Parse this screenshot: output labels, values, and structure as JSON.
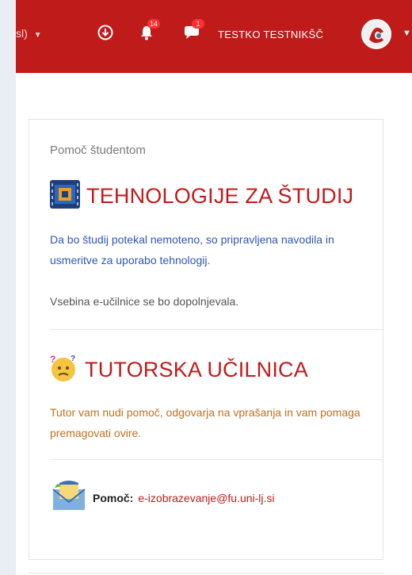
{
  "navbar": {
    "lang_label": "sl)",
    "notif_count": "14",
    "msg_count": "1",
    "user_name": "TESTKO TESTNIKŠČ"
  },
  "block": {
    "title": "Pomoč študentom",
    "section1": {
      "heading": "TEHNOLOGIJE ZA ŠTUDIJ",
      "text": "Da bo študij potekal nemoteno, so pripravljena navodila in usmeritve za uporabo tehnologij.",
      "note": "Vsebina e-učilnice se bo dopolnjevala."
    },
    "section2": {
      "heading": "TUTORSKA UČILNICA",
      "text": "Tutor vam nudi pomoč, odgovarja na vprašanja in vam pomaga premagovati ovire."
    },
    "contact": {
      "label": "Pomoč:",
      "email": "e-izobrazevanje@fu.uni-lj.si"
    }
  },
  "colors": {
    "brand_red": "#c01b1b",
    "link_blue": "#2f57b8",
    "orange_text": "#c07020"
  }
}
